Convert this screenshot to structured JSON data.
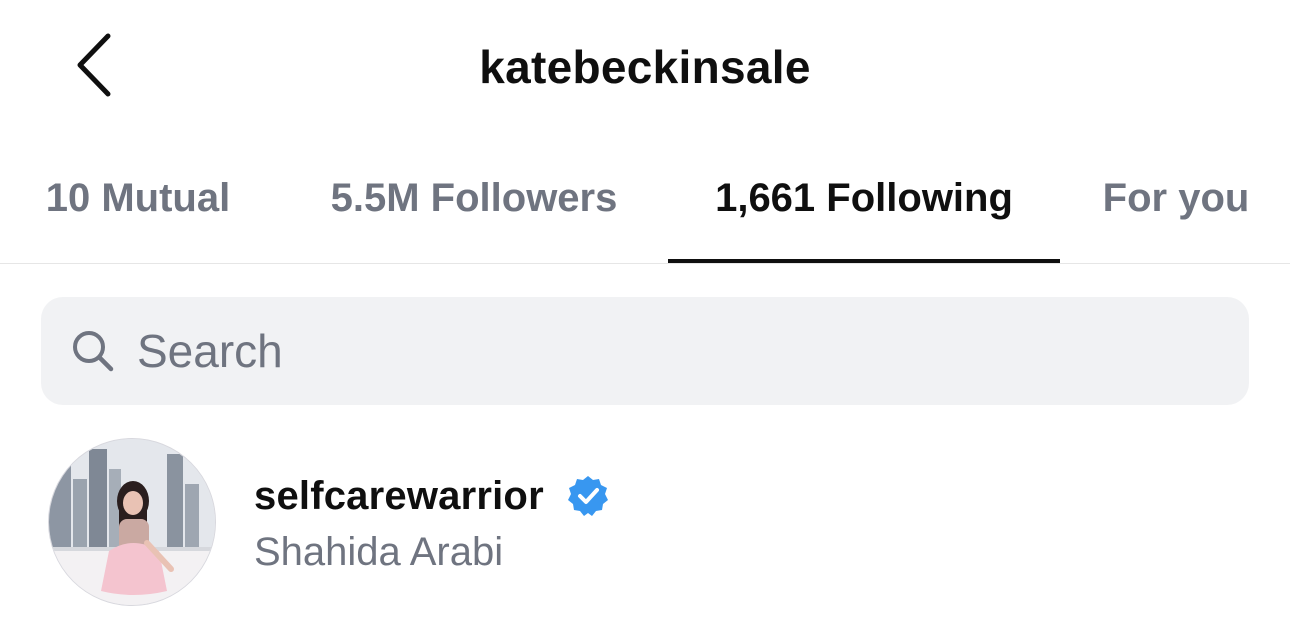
{
  "header": {
    "title": "katebeckinsale",
    "back_icon": "chevron-left-icon"
  },
  "tabs": [
    {
      "label": "10 Mutual",
      "active": false
    },
    {
      "label": "5.5M Followers",
      "active": false
    },
    {
      "label": "1,661 Following",
      "active": true
    },
    {
      "label": "For you",
      "active": false
    }
  ],
  "search": {
    "placeholder": "Search",
    "value": "",
    "icon": "search-icon"
  },
  "accounts": [
    {
      "username": "selfcarewarrior",
      "full_name": "Shahida Arabi",
      "verified": true,
      "verified_icon": "verified-badge-icon"
    }
  ],
  "colors": {
    "text": "#0f0f0f",
    "secondary_text": "#6f7480",
    "search_bg": "#f1f2f4",
    "divider": "#e6e6e6",
    "verified_blue": "#3897f0"
  }
}
